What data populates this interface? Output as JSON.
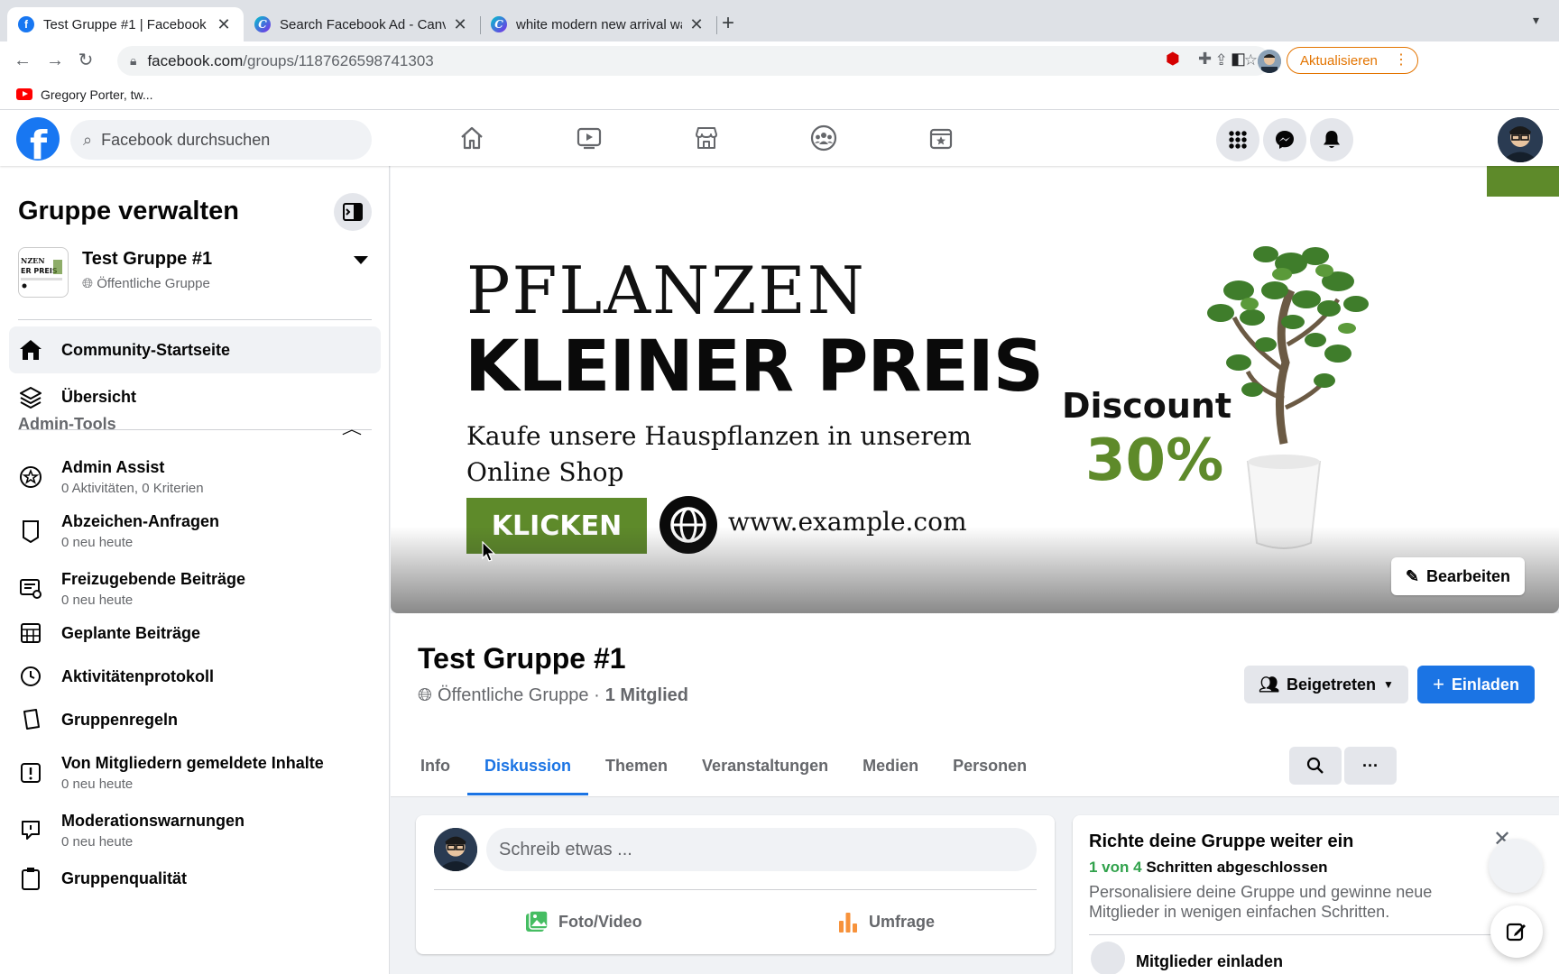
{
  "browser": {
    "tabs": [
      {
        "title": "Test Gruppe #1 | Facebook",
        "favicon": "facebook-icon",
        "active": true
      },
      {
        "title": "Search Facebook Ad - Canva",
        "favicon": "canva-icon",
        "active": false
      },
      {
        "title": "white modern new arrival watc",
        "favicon": "canva-icon",
        "active": false
      }
    ],
    "url_host": "facebook.com",
    "url_path": "/groups/1187626598741303",
    "update_label": "Aktualisieren",
    "bookmark": "Gregory Porter, tw..."
  },
  "fb": {
    "logo": "f",
    "search_placeholder": "Facebook durchsuchen",
    "nav_icons": [
      "home-icon",
      "watch-icon",
      "marketplace-icon",
      "groups-icon",
      "gaming-icon"
    ]
  },
  "sidebar": {
    "title": "Gruppe verwalten",
    "group_name": "Test Gruppe #1",
    "group_privacy": "Öffentliche Gruppe",
    "items": [
      {
        "label": "Community-Startseite"
      },
      {
        "label": "Übersicht"
      }
    ],
    "section_title": "Admin-Tools",
    "admin_items": [
      {
        "label": "Admin Assist",
        "sub": "0 Aktivitäten, 0 Kriterien"
      },
      {
        "label": "Abzeichen-Anfragen",
        "sub": "0 neu heute"
      },
      {
        "label": "Freizugebende Beiträge",
        "sub": "0 neu heute"
      },
      {
        "label": "Geplante Beiträge",
        "sub": ""
      },
      {
        "label": "Aktivitätenprotokoll",
        "sub": ""
      },
      {
        "label": "Gruppenregeln",
        "sub": ""
      },
      {
        "label": "Von Mitgliedern gemeldete Inhalte",
        "sub": "0 neu heute"
      },
      {
        "label": "Moderationswarnungen",
        "sub": "0 neu heute"
      },
      {
        "label": "Gruppenqualität",
        "sub": ""
      }
    ]
  },
  "cover": {
    "line1": "PFLANZEN",
    "line2": "KLEINER PREIS",
    "line3": "Kaufe unsere Hauspflanzen in unserem Online Shop",
    "cta": "KLICKEN",
    "url": "www.example.com",
    "discount_label": "Discount",
    "discount_value": "30%",
    "accent": "#5e8a2a",
    "edit_label": "Bearbeiten"
  },
  "group": {
    "title": "Test Gruppe #1",
    "privacy": "Öffentliche Gruppe ·",
    "members": "1 Mitglied",
    "joined_label": "Beigetreten",
    "invite_label": "Einladen",
    "tabs": [
      "Info",
      "Diskussion",
      "Themen",
      "Veranstaltungen",
      "Medien",
      "Personen"
    ],
    "active_tab": "Diskussion"
  },
  "composer": {
    "placeholder": "Schreib etwas ...",
    "photo_label": "Foto/Video",
    "poll_label": "Umfrage"
  },
  "setup": {
    "title": "Richte deine Gruppe weiter ein",
    "progress_done": "1 von 4",
    "progress_rest": "Schritten abgeschlossen",
    "description": "Personalisiere deine Gruppe und gewinne neue Mitglieder in wenigen einfachen Schritten.",
    "next_step": "Mitglieder einladen"
  }
}
